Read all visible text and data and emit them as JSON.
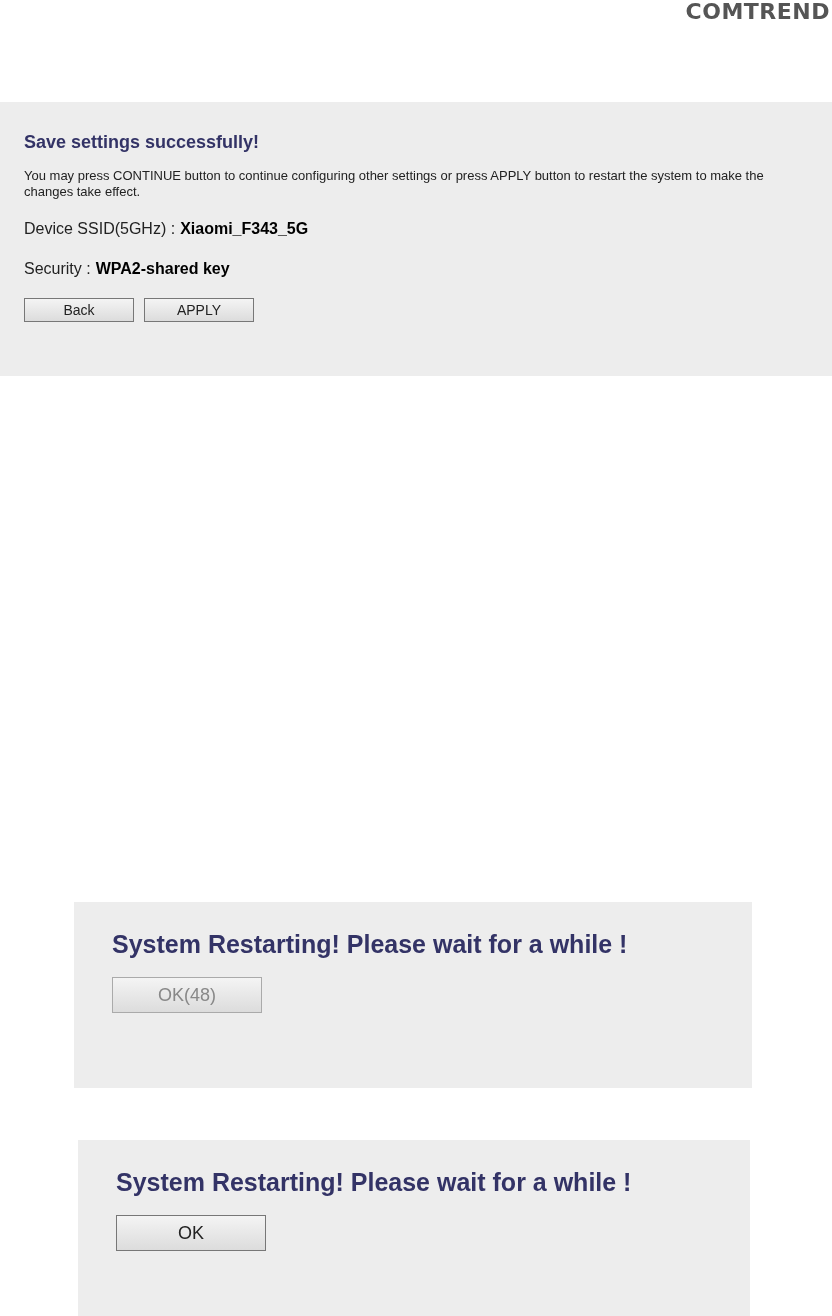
{
  "logo": "COMTREND",
  "save_panel": {
    "title": "Save settings successfully!",
    "message": "You may press CONTINUE button to continue configuring other settings or press APPLY button to restart the system to make the changes take effect.",
    "fields": [
      {
        "label": "Device SSID(5GHz) :",
        "value": "Xiaomi_F343_5G"
      },
      {
        "label": "Security :",
        "value": "WPA2-shared key"
      }
    ],
    "buttons": [
      "Back",
      "APPLY"
    ]
  },
  "restart_panels": [
    {
      "title": "System Restarting! Please wait for a while !",
      "button": {
        "label": "OK(48)",
        "disabled": true
      }
    },
    {
      "title": "System Restarting! Please wait for a while !",
      "button": {
        "label": "OK",
        "disabled": false
      }
    }
  ]
}
